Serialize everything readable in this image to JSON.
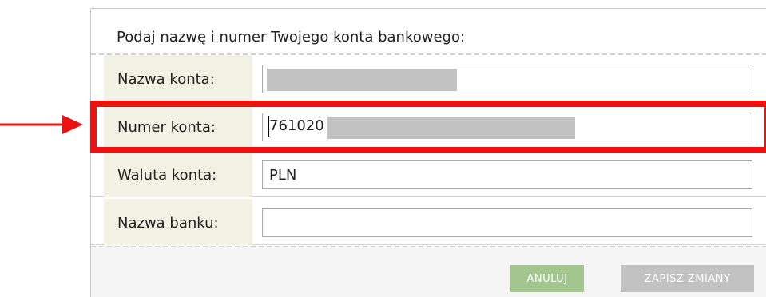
{
  "form": {
    "title": "Podaj nazwę i numer Twojego konta bankowego:",
    "fields": [
      {
        "label": "Nazwa konta:",
        "value": ""
      },
      {
        "label": "Numer konta:",
        "value": "761020"
      },
      {
        "label": "Waluta konta:",
        "value": "PLN"
      },
      {
        "label": "Nazwa banku:",
        "value": ""
      }
    ]
  },
  "buttons": {
    "cancel_label": "ANULUJ",
    "save_label": "ZAPISZ ZMIANY"
  },
  "colors": {
    "label_bg": "#f1f2e3",
    "cancel_bg": "#a3c68f",
    "save_bg": "#c2c2c2",
    "highlight": "#ee1111",
    "redaction": "#c2c2c2"
  },
  "annotation": {
    "arrow_icon": "right-arrow-icon",
    "highlight_target": "Numer konta:"
  }
}
